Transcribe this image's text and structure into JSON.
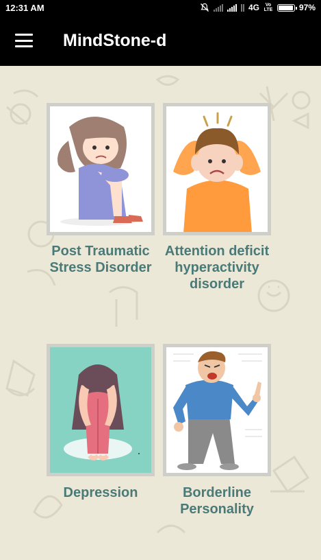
{
  "status_bar": {
    "time": "12:31 AM",
    "network": "4G",
    "volte": "Vo LTE",
    "battery": "97%",
    "battery_level": 0.97
  },
  "app_bar": {
    "title": "MindStone-d",
    "menu_icon": "hamburger-menu-icon"
  },
  "cards": [
    {
      "label": "Post Traumatic Stress Disorder",
      "image": "sad-girl-hugging-knees"
    },
    {
      "label": "Attention deficit hyperactivity disorder",
      "image": "stressed-boy-holding-head"
    },
    {
      "label": "Depression",
      "image": "woman-head-in-knees"
    },
    {
      "label": "Borderline Personality",
      "image": "angry-man-pointing"
    }
  ],
  "colors": {
    "app_bar": "#000000",
    "background": "#ece8d8",
    "label_text": "#4a7a78"
  }
}
